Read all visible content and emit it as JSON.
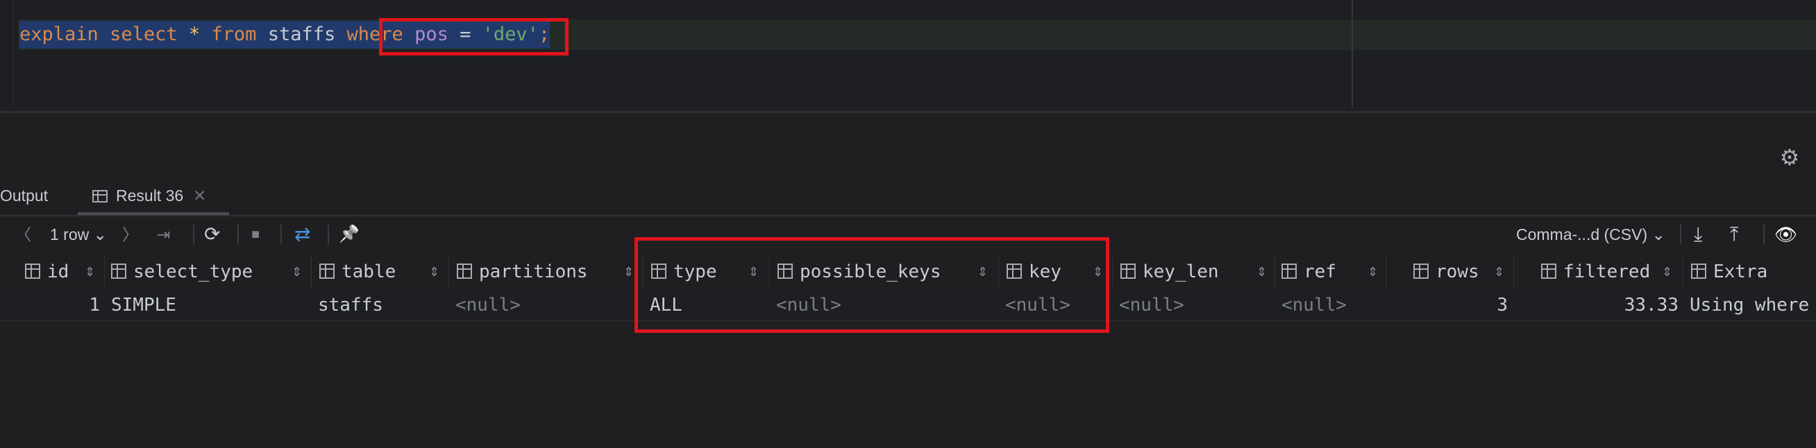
{
  "editor": {
    "query_tokens": [
      {
        "text": "explain",
        "kind": "kw"
      },
      {
        "text": " ",
        "kind": "id"
      },
      {
        "text": "select",
        "kind": "kw"
      },
      {
        "text": " ",
        "kind": "id"
      },
      {
        "text": "*",
        "kind": "op"
      },
      {
        "text": " ",
        "kind": "id"
      },
      {
        "text": "from",
        "kind": "kw"
      },
      {
        "text": " ",
        "kind": "id"
      },
      {
        "text": "staffs",
        "kind": "id"
      },
      {
        "text": " ",
        "kind": "id"
      },
      {
        "text": "where",
        "kind": "kw"
      },
      {
        "text": " ",
        "kind": "id"
      },
      {
        "text": "pos",
        "kind": "col"
      },
      {
        "text": " ",
        "kind": "id"
      },
      {
        "text": "=",
        "kind": "id"
      },
      {
        "text": " ",
        "kind": "id"
      },
      {
        "text": "'dev'",
        "kind": "str"
      },
      {
        "text": ";",
        "kind": "semi"
      }
    ]
  },
  "tabs": {
    "output_label": "Output",
    "result_label": "Result 36",
    "close_glyph": "✕"
  },
  "toolbar": {
    "prev_glyph": "〈",
    "rows_label": "1 row",
    "rows_chevron": "⌄",
    "next_glyph": "〉",
    "last_glyph": "⇥",
    "refresh_glyph": "⟳",
    "stop_glyph": "■",
    "compare_glyph": "⇄",
    "pin_glyph": "📌",
    "export_format": "Comma-...d (CSV)",
    "export_chevron": "⌄",
    "download_glyph": "⤓",
    "upload_glyph": "⤒",
    "view_glyph": "👁"
  },
  "settings_glyph": "⚙",
  "grid": {
    "columns": [
      "id",
      "select_type",
      "table",
      "partitions",
      "type",
      "possible_keys",
      "key",
      "key_len",
      "ref",
      "rows",
      "filtered",
      "Extra"
    ],
    "sort_glyph": "⇕",
    "row": {
      "id": "1",
      "select_type": "SIMPLE",
      "table": "staffs",
      "partitions": "<null>",
      "type": "ALL",
      "possible_keys": "<null>",
      "key": "<null>",
      "key_len": "<null>",
      "ref": "<null>",
      "rows": "3",
      "filtered": "33.33",
      "Extra": "Using where"
    }
  },
  "colors": {
    "highlight_box": "#e0141c",
    "keyword": "#d88a4d",
    "string": "#6faa6f",
    "column": "#b689d2"
  }
}
